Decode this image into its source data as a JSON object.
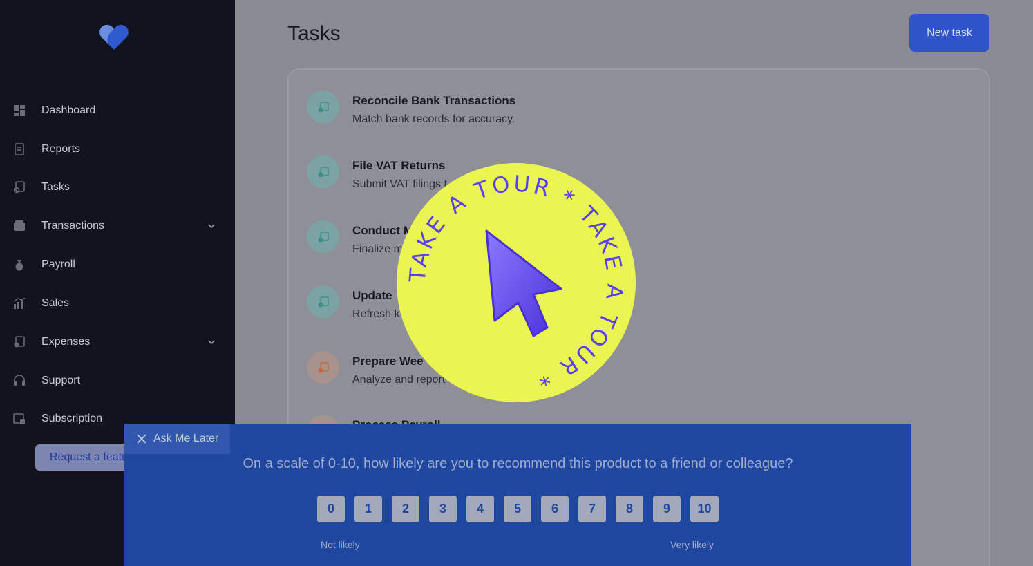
{
  "sidebar": {
    "items": [
      {
        "label": "Dashboard",
        "icon": "dashboard-icon"
      },
      {
        "label": "Reports",
        "icon": "reports-icon"
      },
      {
        "label": "Tasks",
        "icon": "tasks-icon"
      },
      {
        "label": "Transactions",
        "icon": "wallet-icon",
        "expandable": true
      },
      {
        "label": "Payroll",
        "icon": "money-bag-icon"
      },
      {
        "label": "Sales",
        "icon": "sales-chart-icon"
      },
      {
        "label": "Expenses",
        "icon": "expenses-icon",
        "expandable": true
      },
      {
        "label": "Support",
        "icon": "headset-icon"
      },
      {
        "label": "Subscription",
        "icon": "subscription-icon"
      }
    ],
    "request_label": "Request a feature"
  },
  "header": {
    "title": "Tasks",
    "new_task_label": "New task"
  },
  "tasks": [
    {
      "title": "Reconcile Bank Transactions",
      "desc": "Match bank records for accuracy.",
      "status_color": "#5fb3a3"
    },
    {
      "title": "File VAT Returns",
      "desc": "Submit VAT filings t",
      "status_color": "#5fb3a3"
    },
    {
      "title": "Conduct M",
      "desc": "Finalize m",
      "status_color": "#5fb3a3"
    },
    {
      "title": "Update",
      "desc": "Refresh k",
      "status_color": "#5fb3a3"
    },
    {
      "title": "Prepare Wee",
      "desc": "Analyze and report",
      "status_color": "#e08a5a"
    },
    {
      "title": "Process Payroll",
      "desc": "",
      "status_color": "#e08a5a"
    }
  ],
  "tour_badge": {
    "text": "TAKE A TOUR * TAKE A TOUR * ",
    "bg_color": "#ebf552",
    "text_color": "#5b3ff0"
  },
  "survey": {
    "ask_later": "Ask Me Later",
    "question": "On a scale of 0-10, how likely are you to recommend this product to a friend or colleague?",
    "scores": [
      "0",
      "1",
      "2",
      "3",
      "4",
      "5",
      "6",
      "7",
      "8",
      "9",
      "10"
    ],
    "low_label": "Not likely",
    "high_label": "Very likely"
  },
  "colors": {
    "accent": "#2f54c7",
    "sidebar_bg": "#12131f",
    "survey_bg": "#2047a0"
  }
}
